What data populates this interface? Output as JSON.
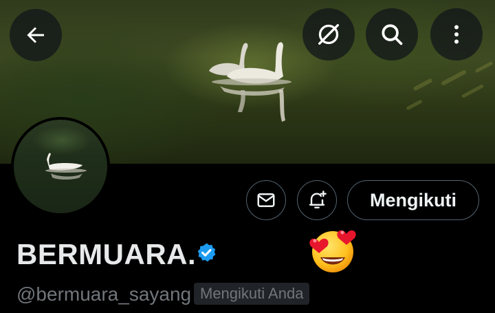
{
  "header": {
    "back_icon": "arrow-left-icon",
    "translate_icon": "no-translate-icon",
    "search_icon": "search-icon",
    "more_icon": "more-vertical-icon"
  },
  "profile": {
    "display_name": "BERMUARA.",
    "verified": true,
    "verified_color": "#1d9bf0",
    "handle": "@bermuara_sayang",
    "follows_you_label": "Mengikuti Anda",
    "emoji": "smiling-face-with-heart-eyes"
  },
  "actions": {
    "message_icon": "envelope-icon",
    "notify_icon": "bell-plus-icon",
    "follow_label": "Mengikuti"
  }
}
